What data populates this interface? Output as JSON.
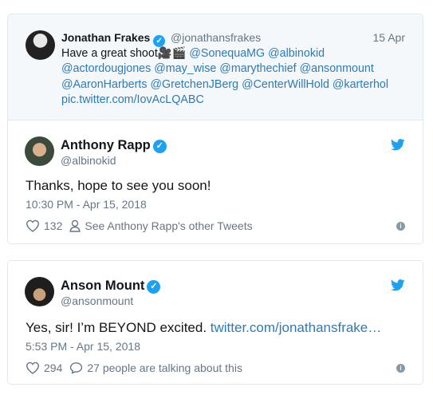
{
  "tweet1": {
    "quoted": {
      "name": "Jonathan Frakes",
      "handle": "@jonathansfrakes",
      "date": "15 Apr",
      "text_plain": "Have a great shoot🎥🎬 ",
      "text_links": "@SonequaMG @albinokid",
      "line2": "@actordougjones @may_wise @marythechief @ansonmount",
      "line3": "@AaronHarberts @GretchenJBerg @CenterWillHold @karterhol",
      "line4": "pic.twitter.com/IovAcLQABC"
    },
    "author": {
      "name": "Anthony Rapp",
      "handle": "@albinokid"
    },
    "text": "Thanks, hope to see you soon!",
    "timestamp": "10:30 PM - Apr 15, 2018",
    "likes": "132",
    "secondary": "See Anthony Rapp's other Tweets"
  },
  "tweet2": {
    "author": {
      "name": "Anson Mount",
      "handle": "@ansonmount"
    },
    "text_plain": "Yes, sir!  I’m BEYOND excited. ",
    "text_link": "twitter.com/jonathansfrake…",
    "timestamp": "5:53 PM - Apr 15, 2018",
    "likes": "294",
    "secondary": "27 people are talking about this"
  },
  "icons": {
    "verified": "verified-badge-icon",
    "bird": "twitter-bird-icon",
    "heart": "heart-icon",
    "person": "person-icon",
    "comment": "comment-bubble-icon",
    "info": "info-icon"
  },
  "colors": {
    "brand_blue": "#1da1f2",
    "link": "#2b7bb9",
    "secondary_text": "#657786",
    "border": "#e1e8ed",
    "quoted_bg": "#f5f8fa"
  }
}
